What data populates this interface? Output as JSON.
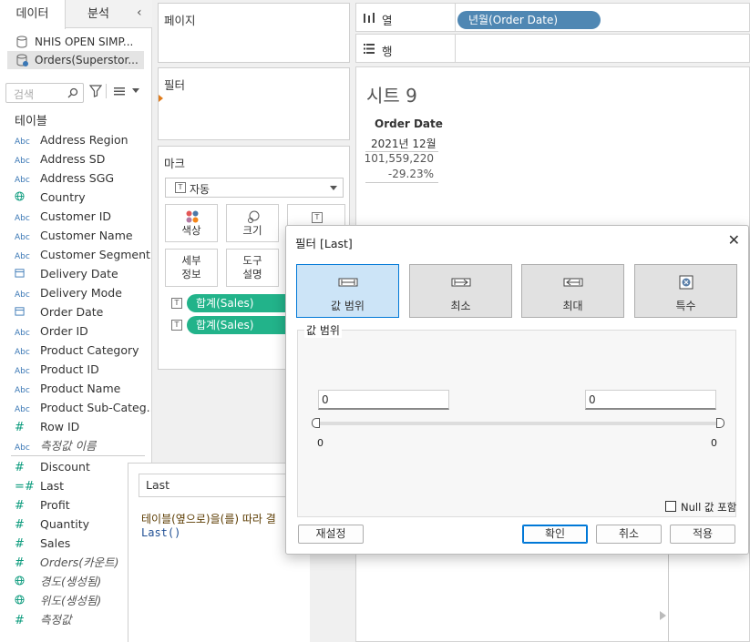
{
  "left_pane": {
    "tabs": [
      "데이터",
      "분석"
    ],
    "datasources": [
      "NHIS OPEN SIMP...",
      "Orders(Superstor..."
    ],
    "search_placeholder": "검색",
    "tables_title": "테이블",
    "dimensions": [
      {
        "type": "Abc",
        "name": "Address Region"
      },
      {
        "type": "Abc",
        "name": "Address SD"
      },
      {
        "type": "Abc",
        "name": "Address SGG"
      },
      {
        "type": "geo",
        "name": "Country"
      },
      {
        "type": "Abc",
        "name": "Customer ID"
      },
      {
        "type": "Abc",
        "name": "Customer Name"
      },
      {
        "type": "Abc",
        "name": "Customer Segment"
      },
      {
        "type": "date",
        "name": "Delivery Date"
      },
      {
        "type": "Abc",
        "name": "Delivery Mode"
      },
      {
        "type": "date",
        "name": "Order Date"
      },
      {
        "type": "Abc",
        "name": "Order ID"
      },
      {
        "type": "Abc",
        "name": "Product Category"
      },
      {
        "type": "Abc",
        "name": "Product ID"
      },
      {
        "type": "Abc",
        "name": "Product Name"
      },
      {
        "type": "Abc",
        "name": "Product Sub-Categ..."
      },
      {
        "type": "#",
        "name": "Row ID"
      },
      {
        "type": "Abc",
        "name": "측정값 이름",
        "italic": true
      }
    ],
    "measures": [
      {
        "type": "#",
        "name": "Discount"
      },
      {
        "type": "=#",
        "name": "Last"
      },
      {
        "type": "#",
        "name": "Profit"
      },
      {
        "type": "#",
        "name": "Quantity"
      },
      {
        "type": "#",
        "name": "Sales"
      },
      {
        "type": "#",
        "name": "Orders(카운트)",
        "italic": true
      },
      {
        "type": "geo",
        "name": "경도(생성됨)",
        "italic": true
      },
      {
        "type": "geo",
        "name": "위도(생성됨)",
        "italic": true
      },
      {
        "type": "#",
        "name": "측정값",
        "italic": true
      }
    ]
  },
  "cards": {
    "pages_title": "페이지",
    "filters_title": "필터",
    "marks_title": "마크",
    "mark_type": "자동",
    "mark_buttons": [
      "색상",
      "크기",
      "세부\n정보",
      "도구\n설명"
    ],
    "pills": [
      "합계(Sales)",
      "합계(Sales)"
    ]
  },
  "shelves": {
    "columns_label": "열",
    "rows_label": "행",
    "column_pill": "년월(Order Date)"
  },
  "sheet": {
    "title": "시트 9",
    "header": "Order Date",
    "subheader": "2021년 12월",
    "value1": "101,559,220",
    "value2": "-29.23%"
  },
  "calc": {
    "name": "Last",
    "description": "테이블(옆으로)을(를) 따라 결",
    "code": "Last()"
  },
  "dialog": {
    "title": "필터 [Last]",
    "tabs": [
      "값 범위",
      "최소",
      "최대",
      "특수"
    ],
    "active_tab": "값 범위",
    "range_legend": "값 범위",
    "min_value": "0",
    "max_value": "0",
    "min_tick": "0",
    "max_tick": "0",
    "null_label": "Null 값 포함",
    "buttons": {
      "reset": "재설정",
      "ok": "확인",
      "cancel": "취소",
      "apply": "적용"
    }
  }
}
